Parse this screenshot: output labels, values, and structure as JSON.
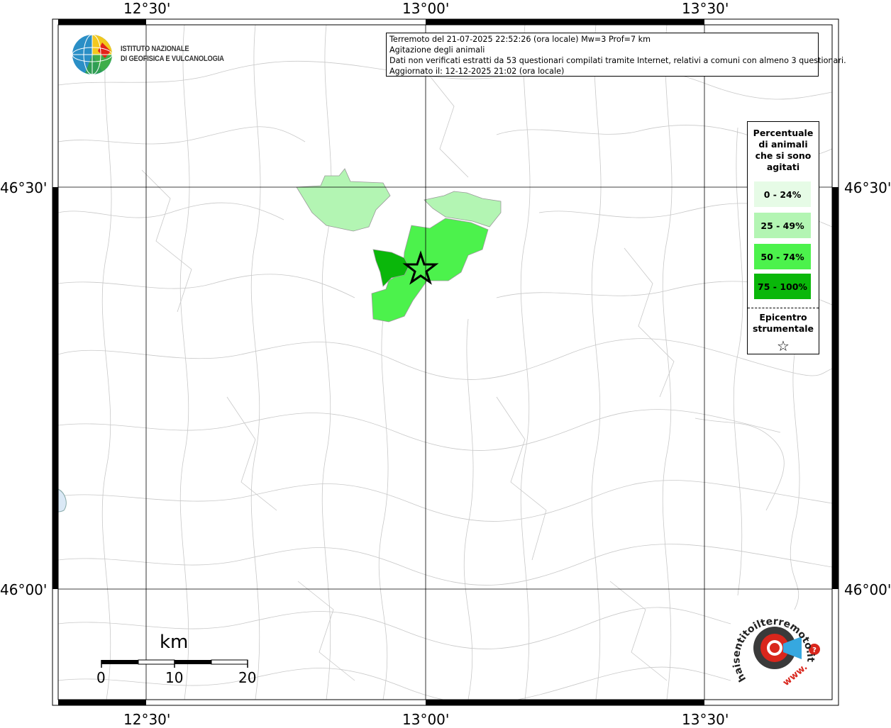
{
  "map": {
    "lon_labels": [
      "12°30'",
      "13°00'",
      "13°30'"
    ],
    "lat_labels": [
      "46°30'",
      "46°00'"
    ],
    "grid": true
  },
  "info": {
    "line1": "Terremoto del 21-07-2025 22:52:26 (ora locale) Mw=3 Prof=7 km",
    "line2": "Agitazione degli animali",
    "line3": "Dati non verificati estratti da 53 questionari compilati tramite Internet, relativi a comuni con almeno 3 questionari.",
    "line4": "Aggiornato il: 12-12-2025 21:02 (ora locale)"
  },
  "legend": {
    "title": "Percentuale di animali che si sono agitati",
    "classes": [
      {
        "label": "0 - 24%",
        "color": "#e6fbe6"
      },
      {
        "label": "25 - 49%",
        "color": "#b3f5b3"
      },
      {
        "label": "50 - 74%",
        "color": "#4cf24c"
      },
      {
        "label": "75 - 100%",
        "color": "#0ab70a"
      }
    ],
    "epicenter_label": "Epicentro strumentale",
    "epicenter_symbol": "☆"
  },
  "logo": {
    "institute_line1": "ISTITUTO NAZIONALE",
    "institute_line2": "DI GEOFISICA E VULCANOLOGIA"
  },
  "scale": {
    "unit": "km",
    "ticks": [
      "0",
      "10",
      "20"
    ]
  },
  "hst_logo": {
    "text": "haisentitoilterremoto.it",
    "prefix": "www."
  }
}
